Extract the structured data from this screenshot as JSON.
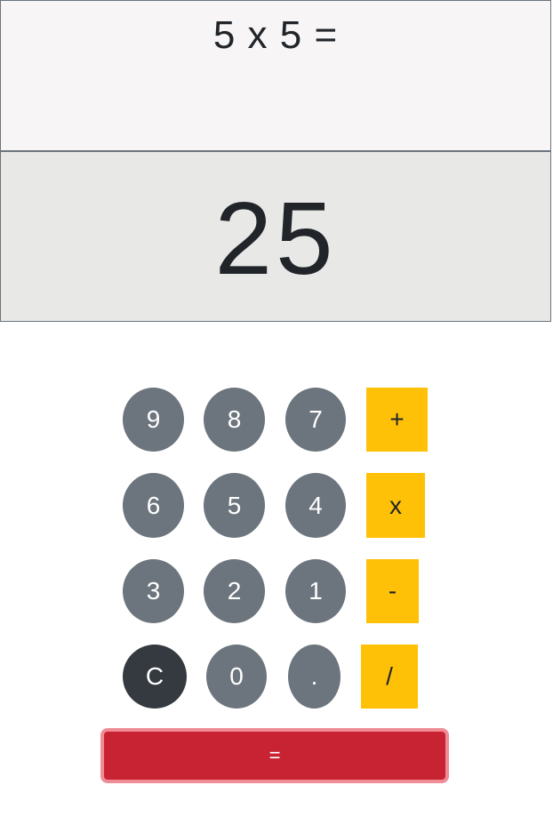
{
  "display": {
    "expression": "5 x 5 =",
    "result": "25"
  },
  "keys": {
    "k9": "9",
    "k8": "8",
    "k7": "7",
    "plus": "+",
    "k6": "6",
    "k5": "5",
    "k4": "4",
    "multiply": "x",
    "k3": "3",
    "k2": "2",
    "k1": "1",
    "minus": "-",
    "clear": "C",
    "k0": "0",
    "dot": ".",
    "divide": "/",
    "equals": "="
  },
  "colors": {
    "number_key": "#6c757d",
    "clear_key": "#343a40",
    "operator_key": "#ffc107",
    "equals_key": "#c82333",
    "expression_bg": "#f7f5f6",
    "result_bg": "#e8e8e6"
  }
}
